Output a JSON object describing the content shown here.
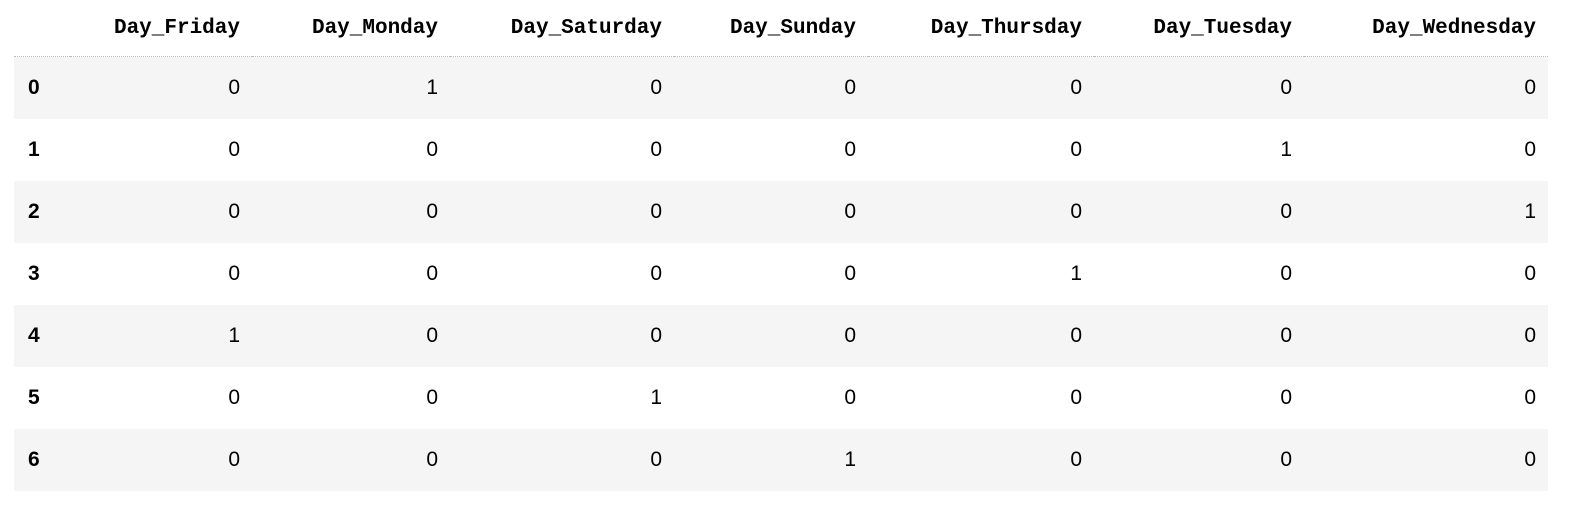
{
  "table": {
    "columns": [
      "Day_Friday",
      "Day_Monday",
      "Day_Saturday",
      "Day_Sunday",
      "Day_Thursday",
      "Day_Tuesday",
      "Day_Wednesday"
    ],
    "rows": [
      {
        "index": "0",
        "values": [
          "0",
          "1",
          "0",
          "0",
          "0",
          "0",
          "0"
        ]
      },
      {
        "index": "1",
        "values": [
          "0",
          "0",
          "0",
          "0",
          "0",
          "1",
          "0"
        ]
      },
      {
        "index": "2",
        "values": [
          "0",
          "0",
          "0",
          "0",
          "0",
          "0",
          "1"
        ]
      },
      {
        "index": "3",
        "values": [
          "0",
          "0",
          "0",
          "0",
          "1",
          "0",
          "0"
        ]
      },
      {
        "index": "4",
        "values": [
          "1",
          "0",
          "0",
          "0",
          "0",
          "0",
          "0"
        ]
      },
      {
        "index": "5",
        "values": [
          "0",
          "0",
          "1",
          "0",
          "0",
          "0",
          "0"
        ]
      },
      {
        "index": "6",
        "values": [
          "0",
          "0",
          "0",
          "1",
          "0",
          "0",
          "0"
        ]
      }
    ]
  }
}
